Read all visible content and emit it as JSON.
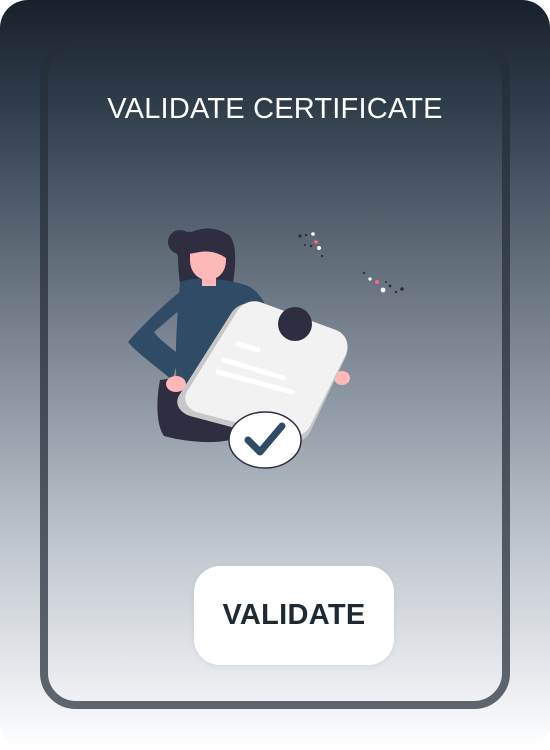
{
  "page": {
    "title": "VALIDATE CERTIFICATE"
  },
  "actions": {
    "validate_label": "VALIDATE"
  },
  "illustration": {
    "icon": "person-holding-certificate-illustration",
    "badge_icon": "checkmark-icon"
  },
  "colors": {
    "button_background": "#ffffff",
    "button_text": "#1f2933",
    "title_text": "#ffffff",
    "jacket": "#2f4b66",
    "hair": "#2f2e41",
    "skin": "#ffb8b8"
  }
}
